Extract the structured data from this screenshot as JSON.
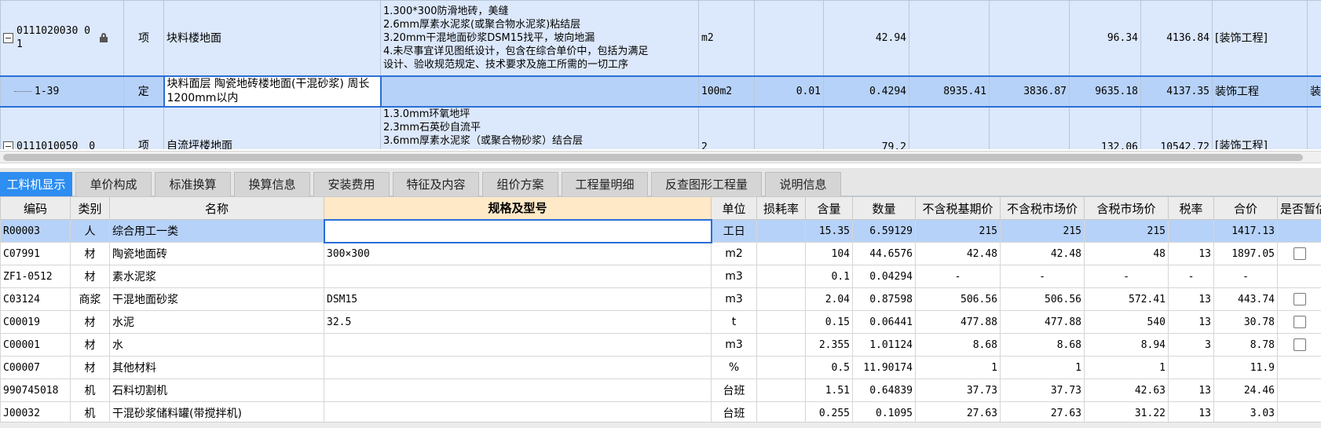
{
  "top_rows": [
    {
      "code": "0111020030 01",
      "type": "项",
      "name": "块料楼地面",
      "desc": [
        "1.300*300防滑地砖，美缝",
        "2.6mm厚素水泥浆(或聚合物水泥浆)粘结层",
        "3.20mm干混地面砂浆DSM15找平，坡向地漏",
        "4.未尽事宜详见图纸设计，包含在综合单价中，包括为满足",
        "设计、验收规范规定、技术要求及施工所需的一切工序"
      ],
      "unit": "m2",
      "c1": "",
      "qty": "42.94",
      "c3": "",
      "c4": "",
      "c5": "96.34",
      "c6": "4136.84",
      "prof": "[装饰工程]"
    },
    {
      "code": "1-39",
      "type": "定",
      "name": "块料面层 陶瓷地砖楼地面(干混砂浆) 周长1200mm以内",
      "desc": [],
      "unit": "100m2",
      "c1": "0.01",
      "qty": "0.4294",
      "c3": "8935.41",
      "c4": "3836.87",
      "c5": "9635.18",
      "c6": "4137.35",
      "prof": "装饰工程",
      "extra": "装饰"
    },
    {
      "code": "0111010050",
      "code_suffix": "0",
      "type": "项",
      "name": "自流坪楼地面",
      "desc": [
        "1.3.0mm环氧地坪",
        "2.3mm石英砂自流平",
        "3.6mm厚素水泥浆（或聚合物砂浆）结合层"
      ],
      "unit": "2",
      "c1": "",
      "qty": "79.2",
      "c3": "",
      "c4": "",
      "c5": "132.06",
      "c6": "10542.72",
      "prof": "[装饰工程]"
    }
  ],
  "tabs": [
    "工料机显示",
    "单价构成",
    "标准换算",
    "换算信息",
    "安装费用",
    "特征及内容",
    "组价方案",
    "工程量明细",
    "反查图形工程量",
    "说明信息"
  ],
  "columns": [
    "编码",
    "类别",
    "名称",
    "规格及型号",
    "单位",
    "损耗率",
    "含量",
    "数量",
    "不含税基期价",
    "不含税市场价",
    "含税市场价",
    "税率",
    "合价",
    "是否暂估"
  ],
  "rows": [
    {
      "code": "R00003",
      "cat": "人",
      "name": "综合用工一类",
      "spec": "",
      "unit": "工日",
      "loss": "",
      "content": "15.35",
      "qty": "6.59129",
      "base": "215",
      "market": "215",
      "tax_market": "215",
      "rate": "",
      "total": "1417.13",
      "check": false
    },
    {
      "code": "C07991",
      "cat": "材",
      "name": "陶瓷地面砖",
      "spec": "300×300",
      "unit": "m2",
      "loss": "",
      "content": "104",
      "qty": "44.6576",
      "base": "42.48",
      "market": "42.48",
      "tax_market": "48",
      "rate": "13",
      "total": "1897.05",
      "check": true
    },
    {
      "code": "ZF1-0512",
      "cat": "材",
      "name": "素水泥浆",
      "spec": "",
      "unit": "m3",
      "loss": "",
      "content": "0.1",
      "qty": "0.04294",
      "base": "-",
      "market": "-",
      "tax_market": "-",
      "rate": "-",
      "total": "-",
      "check": false
    },
    {
      "code": "C03124",
      "cat": "商浆",
      "name": "干混地面砂浆",
      "spec": "DSM15",
      "unit": "m3",
      "loss": "",
      "content": "2.04",
      "qty": "0.87598",
      "base": "506.56",
      "market": "506.56",
      "tax_market": "572.41",
      "rate": "13",
      "total": "443.74",
      "check": true
    },
    {
      "code": "C00019",
      "cat": "材",
      "name": "水泥",
      "spec": "32.5",
      "unit": "t",
      "loss": "",
      "content": "0.15",
      "qty": "0.06441",
      "base": "477.88",
      "market": "477.88",
      "tax_market": "540",
      "rate": "13",
      "total": "30.78",
      "check": true
    },
    {
      "code": "C00001",
      "cat": "材",
      "name": "水",
      "spec": "",
      "unit": "m3",
      "loss": "",
      "content": "2.355",
      "qty": "1.01124",
      "base": "8.68",
      "market": "8.68",
      "tax_market": "8.94",
      "rate": "3",
      "total": "8.78",
      "check": true
    },
    {
      "code": "C00007",
      "cat": "材",
      "name": "其他材料",
      "spec": "",
      "unit": "%",
      "loss": "",
      "content": "0.5",
      "qty": "11.90174",
      "base": "1",
      "market": "1",
      "tax_market": "1",
      "rate": "",
      "total": "11.9",
      "check": false
    },
    {
      "code": "990745018",
      "cat": "机",
      "name": "石料切割机",
      "spec": "",
      "unit": "台班",
      "loss": "",
      "content": "1.51",
      "qty": "0.64839",
      "base": "37.73",
      "market": "37.73",
      "tax_market": "42.63",
      "rate": "13",
      "total": "24.46",
      "check": false
    },
    {
      "code": "J00032",
      "cat": "机",
      "name": "干混砂浆储料罐(带搅拌机)",
      "spec": "",
      "unit": "台班",
      "loss": "",
      "content": "0.255",
      "qty": "0.1095",
      "base": "27.63",
      "market": "27.63",
      "tax_market": "31.22",
      "rate": "13",
      "total": "3.03",
      "check": false
    }
  ]
}
